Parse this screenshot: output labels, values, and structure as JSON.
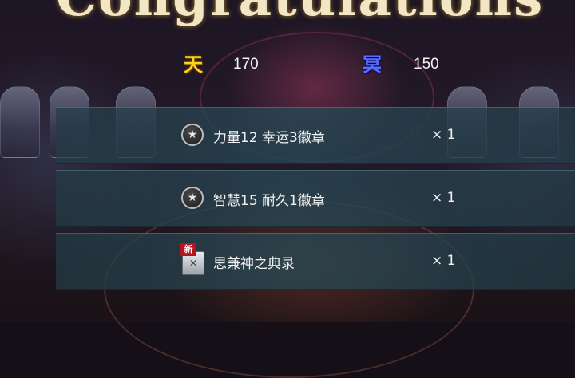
{
  "title": "Congratulations",
  "currencies": [
    {
      "icon": "天",
      "value": "170",
      "color": "#ffd21e"
    },
    {
      "icon": "冥",
      "value": "150",
      "color": "#5a6cff"
    }
  ],
  "rewards": [
    {
      "icon": "badge-icon",
      "name": "力量12 幸运3徽章",
      "qty": "× 1"
    },
    {
      "icon": "badge-icon",
      "name": "智慧15 耐久1徽章",
      "qty": "× 1"
    },
    {
      "icon": "book-icon",
      "new_tag": "新",
      "name": "思兼神之典录",
      "qty": "× 1"
    }
  ]
}
